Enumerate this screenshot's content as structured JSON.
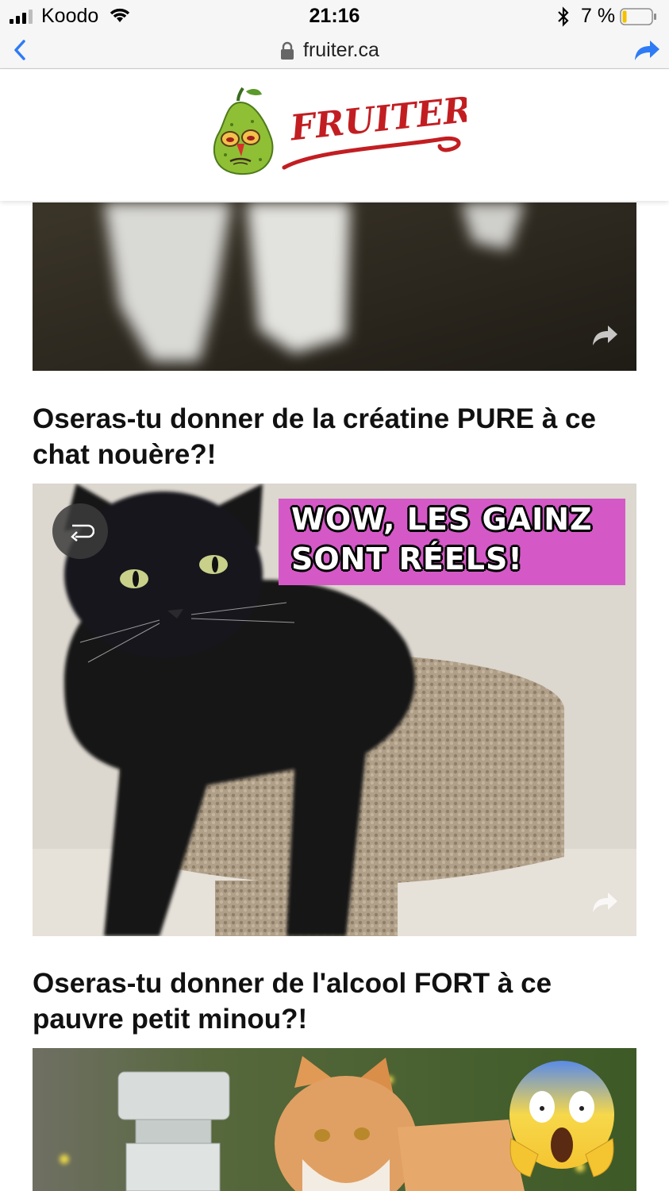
{
  "status_bar": {
    "carrier": "Koodo",
    "time": "21:16",
    "battery_percent": "7 %",
    "battery_level": 0.07,
    "icons": [
      "signal-icon",
      "wifi-icon",
      "bluetooth-icon",
      "battery-icon"
    ]
  },
  "url_bar": {
    "domain": "fruiter.ca",
    "icons": [
      "back-chevron-icon",
      "lock-icon",
      "share-icon"
    ]
  },
  "site": {
    "logo_text": "FRUITER"
  },
  "feed": {
    "articles": [
      {
        "title": "",
        "media_description": "Blurry partial photo, dark background"
      },
      {
        "title": "Oseras-tu donner de la créatine PURE à ce chat nouère?!",
        "caption_line_1": "WOW, LES GAINZ",
        "caption_line_2": "SONT RÉELS!"
      },
      {
        "title": "Oseras-tu donner de l'alcool FORT à ce pauvre petit minou?!"
      }
    ]
  },
  "colors": {
    "accent_blue": "#2f7bf5",
    "logo_red": "#c21e22",
    "caption_pink": "#d459c7"
  }
}
